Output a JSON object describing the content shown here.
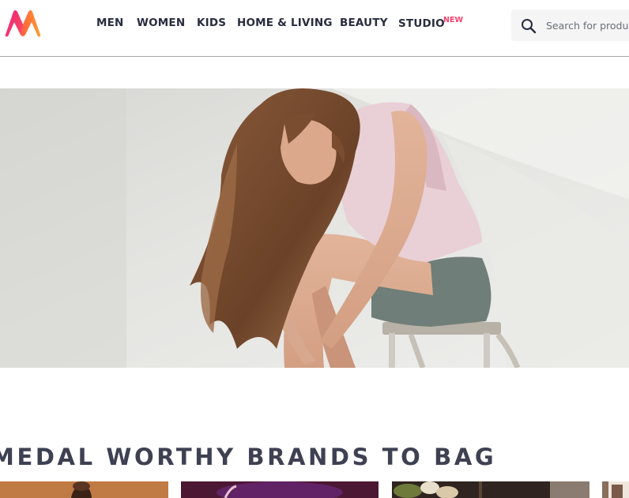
{
  "header": {
    "logo_icon": "myntra-m-logo",
    "nav": [
      {
        "label": "MEN"
      },
      {
        "label": "WOMEN"
      },
      {
        "label": "KIDS"
      },
      {
        "label": "HOME & LIVING"
      },
      {
        "label": "BEAUTY"
      },
      {
        "label": "STUDIO",
        "badge": "NEW"
      }
    ],
    "search": {
      "icon": "search-icon",
      "placeholder": "Search for products, brands and more"
    }
  },
  "hero": {
    "image": "woman-sitting-on-stool-banner"
  },
  "section": {
    "title": "MEDAL WORTHY BRANDS TO BAG"
  },
  "brand_cards": [
    {
      "image": "man-portrait-tile"
    },
    {
      "image": "purple-stage-tile"
    },
    {
      "image": "flowers-tile"
    },
    {
      "image": "partial-tile"
    }
  ],
  "colors": {
    "accent": "#ff3f6c",
    "text": "#282c3f",
    "section_title": "#3e4152",
    "search_bg": "#f5f5f6"
  }
}
